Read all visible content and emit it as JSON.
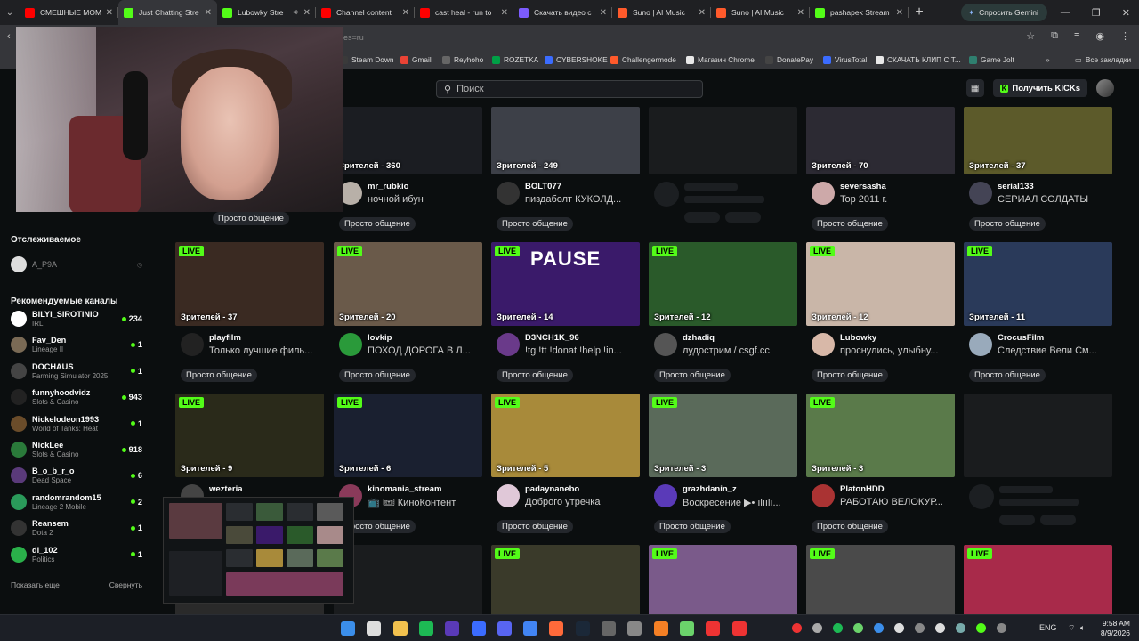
{
  "browser": {
    "tabs": [
      {
        "label": "СМЕШНЫЕ МОМ",
        "color": "#ff0000",
        "active": false
      },
      {
        "label": "Just Chatting Stre",
        "color": "#53fc18",
        "active": true
      },
      {
        "label": "Lubowky Stre",
        "color": "#53fc18",
        "active": false,
        "audio": true
      },
      {
        "label": "Channel content",
        "color": "#ff0000",
        "active": false
      },
      {
        "label": "cast heal - run to",
        "color": "#ff0000",
        "active": false
      },
      {
        "label": "Скачать видео с",
        "color": "#7c5cff",
        "active": false
      },
      {
        "label": "Suno | AI Music",
        "color": "#ff5a2b",
        "active": false
      },
      {
        "label": "Suno | AI Music",
        "color": "#ff5a2b",
        "active": false
      },
      {
        "label": "pashapek Stream",
        "color": "#53fc18",
        "active": false
      }
    ],
    "gemini_label": "Спросить Gemini",
    "url_fragment": "es=ru",
    "bookmarks": [
      {
        "label": "Steam Down",
        "color": "#3a3a3a"
      },
      {
        "label": "Gmail",
        "color": "#ea4335"
      },
      {
        "label": "Reyhoho",
        "color": "#666"
      },
      {
        "label": "ROZETKA",
        "color": "#00a046"
      },
      {
        "label": "CYBERSHOKE",
        "color": "#3b6cff"
      },
      {
        "label": "Challengermode",
        "color": "#ff5a2b"
      },
      {
        "label": "Магазин Chrome",
        "color": "#e8e8e8"
      },
      {
        "label": "DonatePay",
        "color": "#444"
      },
      {
        "label": "VirusTotal",
        "color": "#3b6cff"
      },
      {
        "label": "СКАЧАТЬ КЛИП С Т...",
        "color": "#e8e8e8"
      },
      {
        "label": "Game Jolt",
        "color": "#2f7f6f"
      }
    ],
    "all_bookmarks": "Все закладки"
  },
  "header": {
    "search_placeholder": "Поиск",
    "get_kicks_label": "Получить KICKs"
  },
  "sidebar": {
    "following_title": "Отслеживаемое",
    "followed": [
      {
        "name": "A_P9A"
      }
    ],
    "recommended_title": "Рекомендуемые каналы",
    "channels": [
      {
        "name": "BILYI_SIROTINIO",
        "category": "IRL",
        "viewers": "234",
        "color": "#ffffff"
      },
      {
        "name": "Fav_Den",
        "category": "Lineage II",
        "viewers": "1",
        "color": "#7a6a55"
      },
      {
        "name": "DOCHAUS",
        "category": "Farming Simulator 2025",
        "viewers": "1",
        "color": "#444"
      },
      {
        "name": "funnyhoodvidz",
        "category": "Slots & Casino",
        "viewers": "943",
        "color": "#222"
      },
      {
        "name": "Nickelodeon1993",
        "category": "World of Tanks: Heat",
        "viewers": "1",
        "color": "#6a4c2a"
      },
      {
        "name": "NickLee",
        "category": "Slots & Casino",
        "viewers": "918",
        "color": "#2a7a3a"
      },
      {
        "name": "B_o_b_r_o",
        "category": "Dead Space",
        "viewers": "6",
        "color": "#5a3a7a"
      },
      {
        "name": "randomrandom15",
        "category": "Lineage 2 Mobile",
        "viewers": "2",
        "color": "#2a9a5a"
      },
      {
        "name": "Reansem",
        "category": "Dota 2",
        "viewers": "1",
        "color": "#333"
      },
      {
        "name": "di_102",
        "category": "Politics",
        "viewers": "1",
        "color": "#2ab04a"
      }
    ],
    "show_more": "Показать еще",
    "collapse": "Свернуть"
  },
  "streams": [
    {
      "row": 0,
      "col": 0,
      "viewers": "",
      "name": "",
      "title": "",
      "tag": "Просто общение",
      "live": false,
      "thumb": "#2a2a2a"
    },
    {
      "row": 0,
      "col": 1,
      "viewers": "Зрителей - 360",
      "name": "mr_rubkio",
      "title": "ночной ибун",
      "tag": "Просто общение",
      "live": false,
      "thumb": "#1b1d22",
      "avatar": "#b8b0a8"
    },
    {
      "row": 0,
      "col": 2,
      "viewers": "Зрителей - 249",
      "name": "BOLT077",
      "title": "пиздаболт КУКОЛД...",
      "tag": "Просто общение",
      "live": false,
      "thumb": "#3d4048",
      "avatar": "#333"
    },
    {
      "row": 0,
      "col": 3,
      "viewers": "",
      "name": "",
      "title": "",
      "tag": "",
      "live": false,
      "thumb": "#1a1c1e",
      "skeleton": true
    },
    {
      "row": 0,
      "col": 4,
      "viewers": "Зрителей - 70",
      "name": "seversasha",
      "title": "Top 2011 г.",
      "tag": "Просто общение",
      "live": false,
      "thumb": "#2c2a33",
      "avatar": "#cda9a9"
    },
    {
      "row": 0,
      "col": 5,
      "viewers": "Зрителей - 37",
      "name": "serial133",
      "title": "СЕРИАЛ СОЛДАТЫ",
      "tag": "Просто общение",
      "live": false,
      "thumb": "#5c5a2a",
      "avatar": "#445"
    },
    {
      "row": 1,
      "col": 0,
      "viewers": "Зрителей - 37",
      "name": "playfilm",
      "title": "Только лучшие филь...",
      "tag": "Просто общение",
      "live": true,
      "thumb": "#3a2a22",
      "avatar": "#222"
    },
    {
      "row": 1,
      "col": 1,
      "viewers": "Зрителей - 20",
      "name": "lovkip",
      "title": "ПОХОД ДОРОГА В Л...",
      "tag": "Просто общение",
      "live": true,
      "thumb": "#6a5a4a",
      "avatar": "#2a9a3a"
    },
    {
      "row": 1,
      "col": 2,
      "viewers": "Зрителей - 14",
      "name": "D3NCH1K_96",
      "title": "!tg !tt !donat !help !in...",
      "tag": "Просто общение",
      "live": true,
      "thumb": "#3a1a6a",
      "avatar": "#6a3a8a",
      "pause": "PAUSE"
    },
    {
      "row": 1,
      "col": 3,
      "viewers": "Зрителей - 12",
      "name": "dzhadiq",
      "title": "лудострим / csgf.cc",
      "tag": "Просто общение",
      "live": true,
      "thumb": "#2a5a2a",
      "avatar": "#555"
    },
    {
      "row": 1,
      "col": 4,
      "viewers": "Зрителей - 12",
      "name": "Lubowky",
      "title": "проснулись, улыбну...",
      "tag": "Просто общение",
      "live": true,
      "thumb": "#c9b6a8",
      "avatar": "#d8b8a8"
    },
    {
      "row": 1,
      "col": 5,
      "viewers": "Зрителей - 11",
      "name": "CrocusFilm",
      "title": "Следствие Вели См...",
      "tag": "Просто общение",
      "live": true,
      "thumb": "#2a3a5a",
      "avatar": "#9ab"
    },
    {
      "row": 2,
      "col": 0,
      "viewers": "Зрителей - 9",
      "name": "wezteria",
      "title": "",
      "tag": "",
      "live": true,
      "thumb": "#2a2a1a",
      "avatar": "#444"
    },
    {
      "row": 2,
      "col": 1,
      "viewers": "Зрителей - 6",
      "name": "kinomania_stream",
      "title": "📺 🎟 КиноКонтент",
      "tag": "Просто общение",
      "live": true,
      "thumb": "#1a2030",
      "avatar": "#8a3a5a"
    },
    {
      "row": 2,
      "col": 2,
      "viewers": "Зрителей - 5",
      "name": "padaynanebo",
      "title": "Доброго утречка",
      "tag": "Просто общение",
      "live": true,
      "thumb": "#a88a3a",
      "avatar": "#e0c8d8"
    },
    {
      "row": 2,
      "col": 3,
      "viewers": "Зрителей - 3",
      "name": "grazhdanin_z",
      "title": "Воскресение ▶• ılıılı...",
      "tag": "Просто общение",
      "live": true,
      "thumb": "#5a6a5a",
      "avatar": "#5a3ab8"
    },
    {
      "row": 2,
      "col": 4,
      "viewers": "Зрителей - 3",
      "name": "PlatonHDD",
      "title": "РАБОТАЮ ВЕЛОКУР...",
      "tag": "Просто общение",
      "live": true,
      "thumb": "#5a7a4a",
      "avatar": "#a33"
    },
    {
      "row": 2,
      "col": 5,
      "viewers": "",
      "name": "",
      "title": "",
      "tag": "",
      "live": false,
      "thumb": "#1a1c1e",
      "skeleton": true
    },
    {
      "row": 3,
      "col": 0,
      "viewers": "",
      "name": "",
      "title": "",
      "tag": "",
      "live": false,
      "thumb": "#2a2a2a"
    },
    {
      "row": 3,
      "col": 1,
      "viewers": "",
      "name": "",
      "title": "",
      "tag": "",
      "live": false,
      "thumb": "#1a1c1e"
    },
    {
      "row": 3,
      "col": 2,
      "viewers": "",
      "name": "",
      "title": "",
      "tag": "",
      "live": true,
      "thumb": "#3a3a2a"
    },
    {
      "row": 3,
      "col": 3,
      "viewers": "",
      "name": "",
      "title": "",
      "tag": "",
      "live": true,
      "thumb": "#7a5a8a"
    },
    {
      "row": 3,
      "col": 4,
      "viewers": "",
      "name": "",
      "title": "",
      "tag": "",
      "live": true,
      "thumb": "#4a4a4a"
    },
    {
      "row": 3,
      "col": 5,
      "viewers": "",
      "name": "",
      "title": "",
      "tag": "",
      "live": true,
      "thumb": "#a82a4a"
    }
  ],
  "live_label": "LIVE",
  "taskbar": {
    "lang": "ENG",
    "time": "9:58 AM",
    "date": "8/9/2026"
  }
}
